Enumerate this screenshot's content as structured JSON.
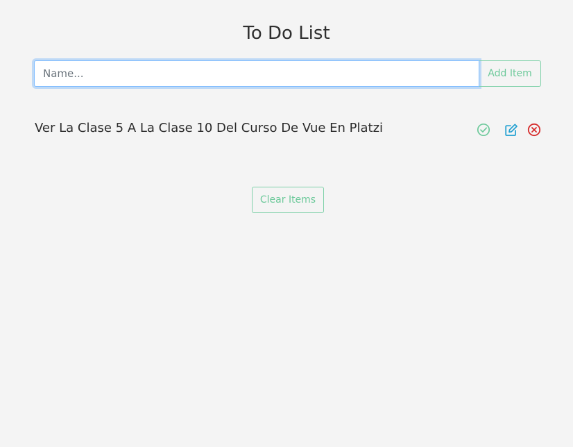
{
  "header": {
    "title": "To Do List"
  },
  "add_form": {
    "input_value": "",
    "input_placeholder": "Name...",
    "add_label": "Add Item"
  },
  "todos": [
    {
      "text": "Ver La Clase 5 A La Clase 10 Del Curso De Vue En Platzi",
      "actions": {
        "complete_icon": "check-circle-icon",
        "edit_icon": "edit-icon",
        "delete_icon": "x-circle-icon"
      }
    }
  ],
  "footer": {
    "clear_label": "Clear Items"
  },
  "colors": {
    "background": "#f4f4f4",
    "success": "#6cc99a",
    "info": "#1f9fd1",
    "danger": "#d62b2b",
    "focus": "#80bdff"
  }
}
